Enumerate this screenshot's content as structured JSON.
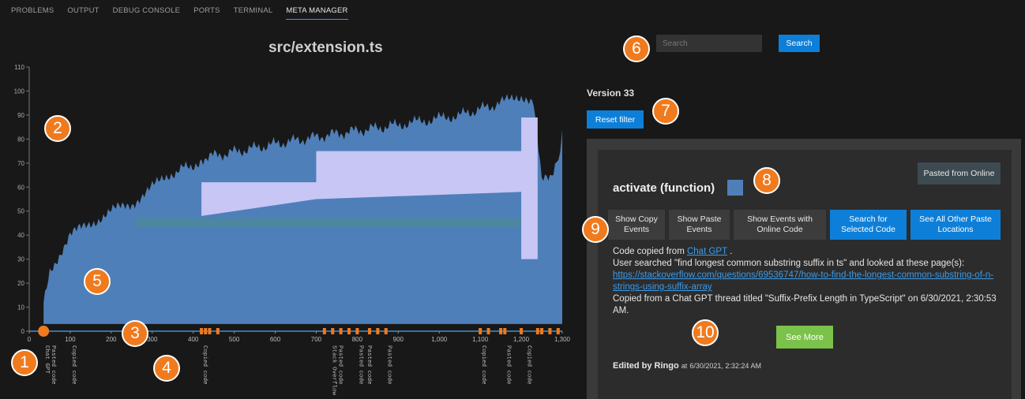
{
  "tabs": [
    "PROBLEMS",
    "OUTPUT",
    "DEBUG CONSOLE",
    "PORTS",
    "TERMINAL",
    "META MANAGER"
  ],
  "file_title": "src/extension.ts",
  "search": {
    "placeholder": "Search",
    "button": "Search"
  },
  "version_label": "Version 33",
  "reset_label": "Reset filter",
  "card": {
    "badge": "Pasted from Online",
    "title": "activate (function)",
    "swatch_color": "#4f7fb8",
    "buttons": [
      "Show Copy Events",
      "Show Paste Events",
      "Show Events with Online Code",
      "Search for Selected Code",
      "See All Other Paste Locations"
    ],
    "copied_prefix": "Code copied from",
    "copied_source": "Chat GPT",
    "copied_suffix": ".",
    "searched_line": "User searched \"find longest common substring suffix in ts\" and looked at these page(s):",
    "link": "https://stackoverflow.com/questions/69536747/how-to-find-the-longest-common-substring-of-n-strings-using-suffix-array",
    "thread_line": "Copied from a Chat GPT thread titled \"Suffix-Prefix Length in TypeScript\" on 6/30/2021, 2:30:53 AM.",
    "see_more": "See More",
    "edited_prefix": "Edited by Ringo",
    "edited_at": "at",
    "edited_time": "6/30/2021, 2:32:24 AM"
  },
  "markers": [
    "1",
    "2",
    "3",
    "4",
    "5",
    "6",
    "7",
    "8",
    "9",
    "10"
  ],
  "chart_data": {
    "type": "area",
    "title": "src/extension.ts",
    "x_ticks": [
      0,
      100,
      200,
      300,
      400,
      500,
      600,
      700,
      800,
      900,
      1000,
      1100,
      1200,
      1300
    ],
    "x_tick_labels": [
      "0",
      "100",
      "200",
      "300",
      "400",
      "500",
      "600",
      "700",
      "800",
      "900",
      "1,000",
      "1,100",
      "1,200",
      "1,300"
    ],
    "y_ticks": [
      0,
      10,
      20,
      30,
      40,
      50,
      60,
      70,
      80,
      90,
      100,
      110
    ],
    "xlim": [
      0,
      1300
    ],
    "ylim": [
      0,
      110
    ],
    "colors": {
      "main": "#4f7fb8",
      "light": "#c7c6f5",
      "teal": "#4c86a0",
      "axis": "#3f8fd6",
      "event": "#f07a1e"
    },
    "series": [
      {
        "x": [
          35,
          50,
          100,
          150,
          200,
          250,
          300,
          350,
          410,
          420,
          600,
          740,
          900,
          1050,
          1150,
          1200,
          1230,
          1250,
          1270,
          1295,
          1300
        ],
        "y": [
          12,
          25,
          40,
          45,
          50,
          53,
          60,
          66,
          70,
          72,
          78,
          82,
          86,
          90,
          95,
          98,
          97,
          62,
          65,
          72,
          84
        ]
      }
    ],
    "light_region": {
      "x": [
        420,
        700,
        700,
        1200,
        1200,
        1240,
        1240
      ],
      "y": [
        62,
        62,
        75,
        75,
        89,
        89,
        30
      ]
    },
    "event_x": [
      35,
      420,
      430,
      440,
      460,
      720,
      740,
      760,
      780,
      800,
      830,
      850,
      870,
      1100,
      1120,
      1150,
      1160,
      1200,
      1240,
      1250,
      1270,
      1290
    ],
    "event_labels": [
      {
        "x": 35,
        "text": "Chat GPT"
      },
      {
        "x": 50,
        "text": "Pasted code"
      },
      {
        "x": 100,
        "text": "Copied code"
      },
      {
        "x": 420,
        "text": "Copied code"
      },
      {
        "x": 735,
        "text": "Stack Overflow"
      },
      {
        "x": 750,
        "text": "Pasted code"
      },
      {
        "x": 800,
        "text": "Pasted code"
      },
      {
        "x": 820,
        "text": "Pasted code"
      },
      {
        "x": 870,
        "text": "Pasted code"
      },
      {
        "x": 1100,
        "text": "Copied code"
      },
      {
        "x": 1160,
        "text": "Pasted code"
      },
      {
        "x": 1210,
        "text": "Copied code"
      }
    ]
  }
}
